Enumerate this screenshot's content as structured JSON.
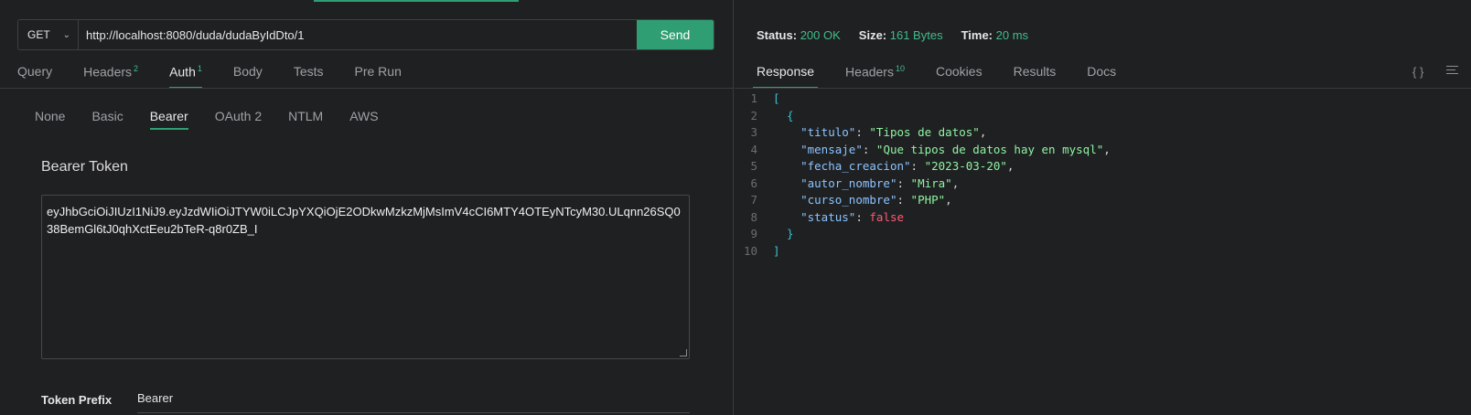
{
  "request": {
    "method": "GET",
    "url": "http://localhost:8080/duda/dudaByIdDto/1",
    "send_label": "Send"
  },
  "request_tabs": [
    {
      "label": "Query",
      "badge": ""
    },
    {
      "label": "Headers",
      "badge": "2"
    },
    {
      "label": "Auth",
      "badge": "1"
    },
    {
      "label": "Body",
      "badge": ""
    },
    {
      "label": "Tests",
      "badge": ""
    },
    {
      "label": "Pre Run",
      "badge": ""
    }
  ],
  "auth_types": [
    "None",
    "Basic",
    "Bearer",
    "OAuth 2",
    "NTLM",
    "AWS"
  ],
  "auth": {
    "title": "Bearer Token",
    "token": "eyJhbGciOiJIUzI1NiJ9.eyJzdWIiOiJTYW0iLCJpYXQiOjE2ODkwMzkzMjMsImV4cCI6MTY4OTEyNTcyM30.ULqnn26SQ038BemGl6tJ0qhXctEeu2bTeR-q8r0ZB_I",
    "prefix_label": "Token Prefix",
    "prefix_value": "Bearer"
  },
  "response": {
    "status_label": "Status:",
    "status_value": "200 OK",
    "size_label": "Size:",
    "size_value": "161 Bytes",
    "time_label": "Time:",
    "time_value": "20 ms"
  },
  "response_tabs": [
    {
      "label": "Response",
      "badge": ""
    },
    {
      "label": "Headers",
      "badge": "10"
    },
    {
      "label": "Cookies",
      "badge": ""
    },
    {
      "label": "Results",
      "badge": ""
    },
    {
      "label": "Docs",
      "badge": ""
    }
  ],
  "icons": {
    "format": "braces-icon",
    "menu": "menu-icon"
  },
  "body": {
    "titulo": "Tipos de datos",
    "mensaje": "Que tipos de datos hay en mysql",
    "fecha_creacion": "2023-03-20",
    "autor_nombre": "Mira",
    "curso_nombre": "PHP",
    "status": "false"
  },
  "colors": {
    "accent": "#2f9e72",
    "background": "#1f2022"
  }
}
